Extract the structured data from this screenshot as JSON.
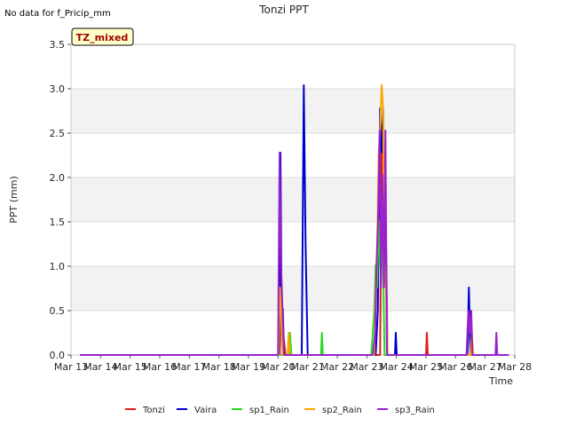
{
  "chart_data": {
    "type": "line",
    "title": "Tonzi PPT",
    "note": "No data for f_Pricip_mm",
    "badge": "TZ_mixed",
    "xlabel": "Time",
    "ylabel": "PPT (mm)",
    "ylim": [
      0,
      3.5
    ],
    "xlim": [
      13,
      28
    ],
    "yticks": [
      {
        "v": 0.0,
        "label": "0.0"
      },
      {
        "v": 0.5,
        "label": "0.5"
      },
      {
        "v": 1.0,
        "label": "1.0"
      },
      {
        "v": 1.5,
        "label": "1.5"
      },
      {
        "v": 2.0,
        "label": "2.0"
      },
      {
        "v": 2.5,
        "label": "2.5"
      },
      {
        "v": 3.0,
        "label": "3.0"
      },
      {
        "v": 3.5,
        "label": "3.5"
      }
    ],
    "xticks": [
      {
        "v": 13,
        "label": "Mar 13"
      },
      {
        "v": 14,
        "label": "Mar 14"
      },
      {
        "v": 15,
        "label": "Mar 15"
      },
      {
        "v": 16,
        "label": "Mar 16"
      },
      {
        "v": 17,
        "label": "Mar 17"
      },
      {
        "v": 18,
        "label": "Mar 18"
      },
      {
        "v": 19,
        "label": "Mar 19"
      },
      {
        "v": 20,
        "label": "Mar 20"
      },
      {
        "v": 21,
        "label": "Mar 21"
      },
      {
        "v": 22,
        "label": "Mar 22"
      },
      {
        "v": 23,
        "label": "Mar 23"
      },
      {
        "v": 24,
        "label": "Mar 24"
      },
      {
        "v": 25,
        "label": "Mar 25"
      },
      {
        "v": 26,
        "label": "Mar 26"
      },
      {
        "v": 27,
        "label": "Mar 27"
      },
      {
        "v": 28,
        "label": "Mar 28"
      }
    ],
    "grid": true,
    "legend_position": "bottom",
    "series": [
      {
        "name": "Tonzi",
        "color": "#e31a1c",
        "x": [
          13.3,
          20.05,
          20.1,
          20.17,
          20.25,
          23.45,
          23.5,
          23.55,
          23.6,
          23.65,
          23.7,
          25.0,
          25.03,
          25.06,
          27.8
        ],
        "y": [
          0,
          0,
          0.52,
          0.25,
          0,
          0,
          2.28,
          1.25,
          1.02,
          1.25,
          0,
          0,
          0.25,
          0,
          0
        ]
      },
      {
        "name": "Vaira",
        "color": "#0000cc",
        "x": [
          13.3,
          20.04,
          20.08,
          20.12,
          20.16,
          20.2,
          20.8,
          20.87,
          20.93,
          21.0,
          23.3,
          23.37,
          23.45,
          23.5,
          23.55,
          23.6,
          23.65,
          23.68,
          23.95,
          23.98,
          24.01,
          26.4,
          26.45,
          26.5,
          27.8
        ],
        "y": [
          0,
          0,
          2.28,
          0.5,
          0.52,
          0,
          0,
          3.04,
          1.25,
          0,
          0,
          0.5,
          2.78,
          2.28,
          2.78,
          1.02,
          1.25,
          0,
          0,
          0.25,
          0,
          0,
          0.76,
          0,
          0
        ]
      },
      {
        "name": "sp1_Rain",
        "color": "#22dd22",
        "x": [
          13.3,
          20.35,
          20.4,
          20.45,
          21.45,
          21.48,
          21.51,
          23.15,
          23.2,
          23.25,
          23.3,
          23.35,
          23.4,
          23.45,
          23.5,
          23.55,
          23.6,
          27.8
        ],
        "y": [
          0,
          0,
          0.25,
          0,
          0,
          0.25,
          0,
          0,
          0.25,
          0.5,
          1.02,
          0.76,
          1.52,
          1.0,
          1.25,
          1.0,
          0,
          0
        ]
      },
      {
        "name": "sp2_Rain",
        "color": "#ffa500",
        "x": [
          13.3,
          20.02,
          20.06,
          20.1,
          20.15,
          20.32,
          20.36,
          20.4,
          23.25,
          23.3,
          23.35,
          23.4,
          23.45,
          23.5,
          23.55,
          23.6,
          23.65,
          23.7,
          26.5,
          26.55,
          26.6,
          27.8
        ],
        "y": [
          0,
          0,
          0.76,
          0.5,
          0,
          0,
          0.25,
          0,
          0,
          0.76,
          1.25,
          2.28,
          2.53,
          3.04,
          2.78,
          1.02,
          0.76,
          0,
          0,
          0.25,
          0,
          0
        ]
      },
      {
        "name": "sp3_Rain",
        "color": "#9922cc",
        "x": [
          13.3,
          20.0,
          20.05,
          20.1,
          20.15,
          20.2,
          23.2,
          23.28,
          23.33,
          23.38,
          23.43,
          23.48,
          23.53,
          23.58,
          23.63,
          23.68,
          26.37,
          26.43,
          26.48,
          26.53,
          26.57,
          27.35,
          27.38,
          27.41,
          27.8
        ],
        "y": [
          0,
          0,
          2.28,
          1.02,
          0.5,
          0,
          0,
          0.25,
          1.02,
          1.52,
          2.53,
          0.76,
          2.03,
          0.76,
          2.53,
          0,
          0,
          0.5,
          0.25,
          0.5,
          0,
          0,
          0.25,
          0,
          0
        ]
      }
    ]
  }
}
